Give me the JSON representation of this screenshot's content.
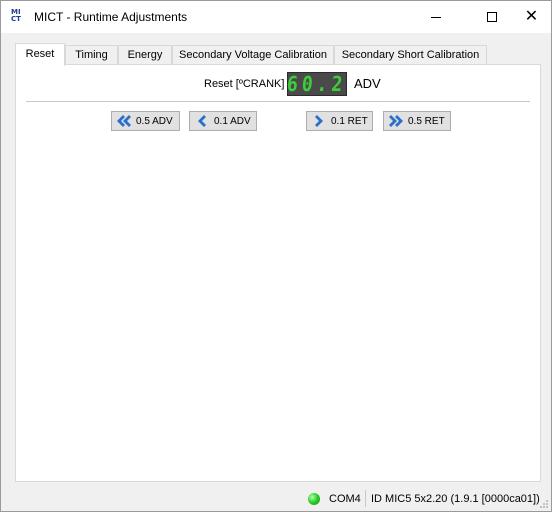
{
  "window": {
    "title": "MICT - Runtime Adjustments",
    "icon": {
      "name": "mict-logo-icon",
      "line1": "MI",
      "line2": "CT",
      "color": "#1f3c88"
    },
    "controls": {
      "minimize": "minimize-icon",
      "maximize": "maximize-icon",
      "close": "close-icon",
      "close_glyph": "✕"
    }
  },
  "tabs": [
    {
      "label": "Reset",
      "active": true
    },
    {
      "label": "Timing",
      "active": false
    },
    {
      "label": "Energy",
      "active": false
    },
    {
      "label": "Secondary Voltage Calibration",
      "active": false
    },
    {
      "label": "Secondary Short Calibration",
      "active": false
    }
  ],
  "reset_panel": {
    "label": "Reset [ºCRANK]",
    "display_value": "60.2",
    "display_color": "#3ccf3c",
    "unit": "ADV",
    "buttons": [
      {
        "label": "0.5 ADV",
        "icon": "double-chevron-left-icon"
      },
      {
        "label": "0.1 ADV",
        "icon": "chevron-left-icon"
      },
      {
        "label": "0.1 RET",
        "icon": "chevron-right-icon"
      },
      {
        "label": "0.5 RET",
        "icon": "double-chevron-right-icon"
      }
    ],
    "icon_color": "#2a6fc9"
  },
  "status_bar": {
    "connection_led": "green-status-led",
    "led_color": "#2fd12f",
    "port": "COM4",
    "device_id": "ID MIC5 5x2.20 (1.9.1 [0000ca01])"
  }
}
